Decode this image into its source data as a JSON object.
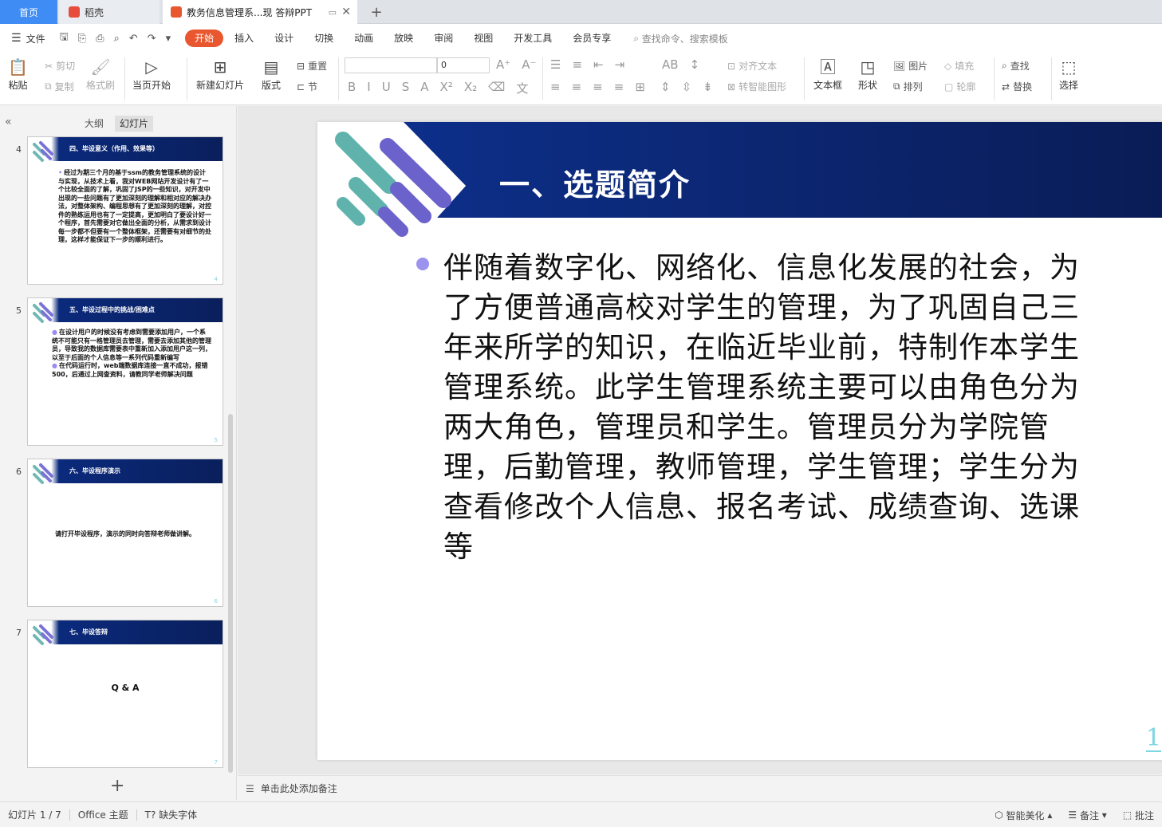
{
  "tabs": {
    "home": "首页",
    "daoke": "稻壳",
    "doc": "教务信息管理系...现 答辩PPT",
    "add": "+",
    "close": "✕",
    "minimize": "▭"
  },
  "menu": {
    "file": "文件",
    "tabs": [
      "开始",
      "插入",
      "设计",
      "切换",
      "动画",
      "放映",
      "审阅",
      "视图",
      "开发工具",
      "会员专享"
    ],
    "search": "查找命令、搜索模板"
  },
  "ribbon": {
    "paste": "粘贴",
    "cut": "剪切",
    "copy": "复制",
    "format_painter": "格式刷",
    "from_current": "当页开始",
    "new_slide": "新建幻灯片",
    "layout": "版式",
    "reset": "重置",
    "section": "节",
    "font_size": "0",
    "align_text": "对齐文本",
    "smartart": "转智能图形",
    "textbox": "文本框",
    "shape": "形状",
    "picture": "图片",
    "arrange": "排列",
    "fill": "填充",
    "outline": "轮廓",
    "find": "查找",
    "replace": "替换",
    "select": "选择"
  },
  "left_panel": {
    "tab_outline": "大纲",
    "tab_slides": "幻灯片",
    "thumbs": [
      {
        "num": "4",
        "title": "四、毕设意义（作用、效果等）",
        "body": "经过为期三个月的基于ssm的教务管理系统的设计与实现，从技术上看，我对WEB网站开发设计有了一个比较全面的了解，巩固了JSP的一些知识，对开发中出现的一些问题有了更加深刻的理解和相对应的解决办法，对整体架构、编程思想有了更加深刻的理解，对控件的熟练运用也有了一定提高，更加明白了要设计好一个程序，首先需要对它做出全面的分析，从需求到设计每一步都不但要有一个整体框架，还需要有对细节的处理，这样才能保证下一步的顺利进行。",
        "page": "4"
      },
      {
        "num": "5",
        "title": "五、毕设过程中的挑战/困难点",
        "bullet1": "在设计用户的时候没有考虑到需要添加用户，一个系统不可能只有一格管理员去管理，需要去添加其他的管理员，导致我的数据库需要表中重新加入添加用户这一列，以至于后面的个人信息等一系列代码重新编写",
        "bullet2": "在代码运行时，web端数据库连接一直不成功，报错500，后通过上网查资料，请教同学老师解决问题",
        "page": "5"
      },
      {
        "num": "6",
        "title": "六、毕设程序演示",
        "body": "请打开毕设程序，演示的同时向答辩老师做讲解。",
        "page": "6"
      },
      {
        "num": "7",
        "title": "七、毕设答辩",
        "body": "Q & A",
        "page": "7"
      }
    ],
    "add": "+"
  },
  "slide": {
    "title": "一、选题简介",
    "body": "伴随着数字化、网络化、信息化发展的社会，为了方便普通高校对学生的管理，为了巩固自己三年来所学的知识，在临近毕业前，特制作本学生管理系统。此学生管理系统主要可以由角色分为两大角色，管理员和学生。管理员分为学院管理，后勤管理，教师管理，学生管理；学生分为查看修改个人信息、报名考试、成绩查询、选课等",
    "page": "1"
  },
  "notes": {
    "placeholder": "单击此处添加备注"
  },
  "status": {
    "slide_count": "幻灯片 1 / 7",
    "theme": "Office 主题",
    "missing_font": "缺失字体",
    "smart_beautify": "智能美化",
    "notes": "备注",
    "comments": "批注"
  },
  "colors": {
    "accent_orange": "#e8572f",
    "home_blue": "#3f8cf5",
    "slide_navy": "#0a1f5c",
    "bullet_purple": "#9b93ee",
    "page_cyan": "#7fd6e2"
  }
}
